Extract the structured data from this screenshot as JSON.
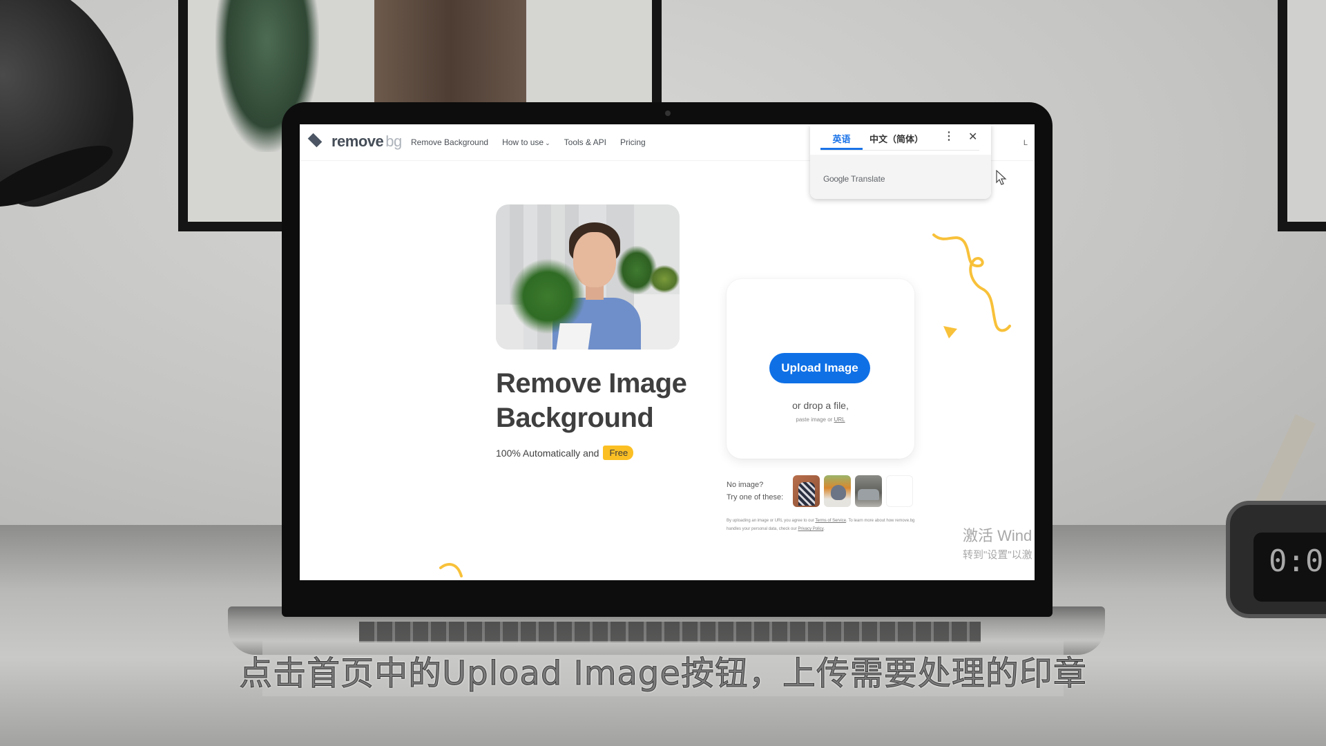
{
  "site": {
    "logo_main": "remove",
    "logo_sub": "bg",
    "nav": {
      "items": [
        {
          "label": "Remove Background"
        },
        {
          "label": "How to use",
          "has_dropdown": true
        },
        {
          "label": "Tools & API"
        },
        {
          "label": "Pricing"
        }
      ],
      "right_partial": "L"
    },
    "hero": {
      "title_line1": "Remove Image",
      "title_line2": "Background",
      "subtitle": "100% Automatically and",
      "badge": "Free"
    },
    "upload": {
      "button_label": "Upload Image",
      "drop_text": "or drop a file,",
      "paste_text": "paste image or",
      "url_link": "URL"
    },
    "samples": {
      "label_line1": "No image?",
      "label_line2": "Try one of these:",
      "thumbnails": [
        "person-sample",
        "pigeon-sample",
        "car-sample",
        "blank-sample"
      ]
    },
    "legal": {
      "part1": "By uploading an image or URL you agree to our",
      "tos_link": "Terms of Service",
      "part2": ". To learn more about how remove.bg handles your personal data, check our",
      "privacy_link": "Privacy Policy",
      "part3": "."
    },
    "colors": {
      "primary_button": "#0f70e6",
      "accent_yellow": "#fbbf24",
      "text_dark": "#3f3f3f"
    }
  },
  "google_translate": {
    "tabs": [
      {
        "label": "英语",
        "active": true
      },
      {
        "label": "中文（简体）",
        "active": false
      }
    ],
    "more_icon": "⋮",
    "close_icon": "✕",
    "brand_google": "Google",
    "brand_translate": "Translate",
    "accent": "#1a73e8"
  },
  "windows_watermark": {
    "line1": "激活 Wind",
    "line2": "转到\"设置\"以激"
  },
  "video_subtitle": "点击首页中的Upload Image按钮，上传需要处理的印章",
  "clock_display": "0:0"
}
